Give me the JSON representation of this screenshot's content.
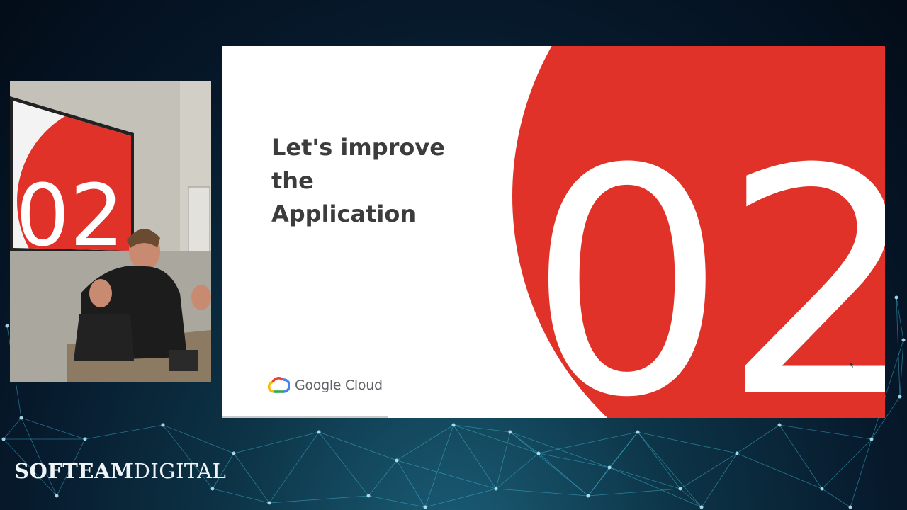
{
  "slide": {
    "title_lines": [
      "Let's improve",
      "the",
      "Application"
    ],
    "section_number": "02",
    "brand_logo_text": "Google Cloud",
    "brand_icon": "google-cloud-icon",
    "accent_color": "#e1322a",
    "progress": 0.25
  },
  "webcam": {
    "screen_number": "02"
  },
  "watermark": {
    "strong": "SOFTEAM",
    "light": "DIGITAL"
  },
  "colors": {
    "background": "#06182a",
    "network_lines": "#3fb8d8"
  }
}
